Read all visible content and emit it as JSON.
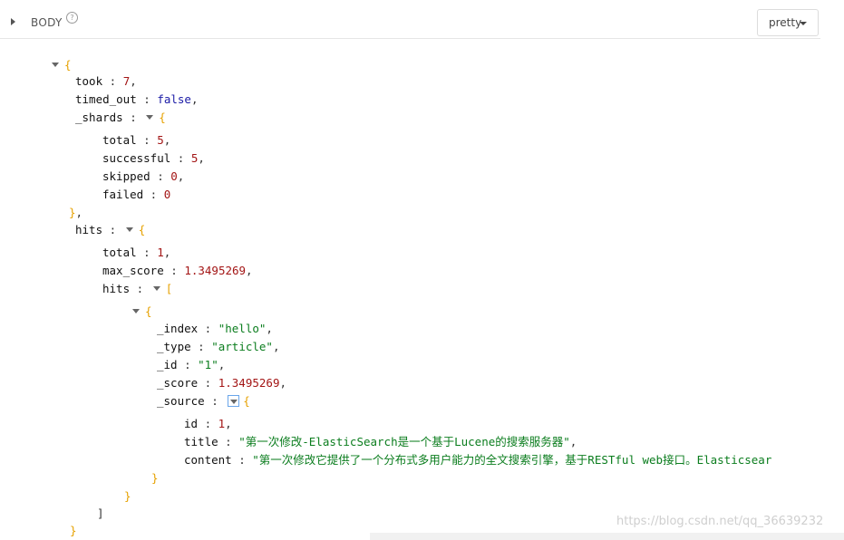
{
  "header": {
    "section_label": "BODY",
    "help_glyph": "?",
    "format_button": "pretty"
  },
  "json_view": {
    "open_root": "{",
    "took_key": "took",
    "took_val": "7",
    "timed_out_key": "timed_out",
    "timed_out_val": "false",
    "shards_key": "_shards",
    "shards_total_key": "total",
    "shards_total_val": "5",
    "shards_successful_key": "successful",
    "shards_successful_val": "5",
    "shards_skipped_key": "skipped",
    "shards_skipped_val": "0",
    "shards_failed_key": "failed",
    "shards_failed_val": "0",
    "hits_key": "hits",
    "hits_total_key": "total",
    "hits_total_val": "1",
    "max_score_key": "max_score",
    "max_score_val": "1.3495269",
    "hits_array_key": "hits",
    "index_key": "_index",
    "index_val": "\"hello\"",
    "type_key": "_type",
    "type_val": "\"article\"",
    "id_key": "_id",
    "id_val": "\"1\"",
    "score_key": "_score",
    "score_val": "1.3495269",
    "source_key": "_source",
    "src_id_key": "id",
    "src_id_val": "1",
    "src_title_key": "title",
    "src_title_val": "\"第一次修改-ElasticSearch是一个基于Lucene的搜索服务器\"",
    "src_content_key": "content",
    "src_content_val": "\"第一次修改它提供了一个分布式多用户能力的全文搜索引擎，基于RESTful web接口。Elasticsear"
  },
  "watermark": "https://blog.csdn.net/qq_36639232"
}
